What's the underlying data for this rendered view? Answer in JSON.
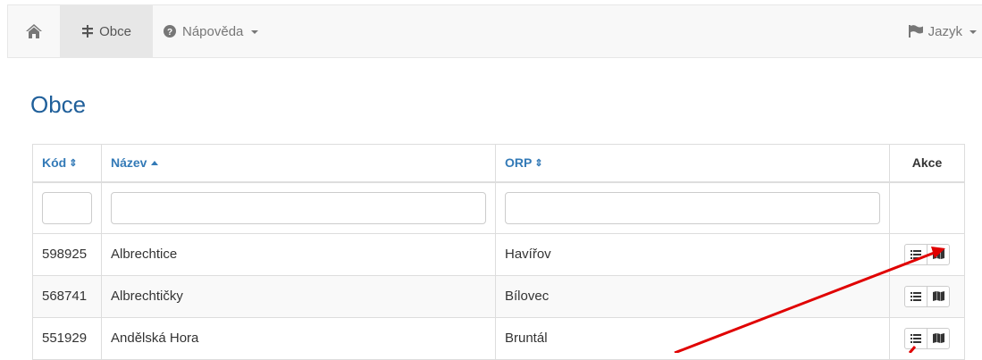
{
  "navbar": {
    "home_icon": "home-icon",
    "obce_label": "Obce",
    "help_label": "Nápověda",
    "lang_label": "Jazyk"
  },
  "page": {
    "title": "Obce"
  },
  "table": {
    "col_kod": "Kód",
    "col_nazev": "Název",
    "col_orp": "ORP",
    "col_akce": "Akce",
    "rows": [
      {
        "kod": "598925",
        "nazev": "Albrechtice",
        "orp": "Havířov"
      },
      {
        "kod": "568741",
        "nazev": "Albrechtičky",
        "orp": "Bílovec"
      },
      {
        "kod": "551929",
        "nazev": "Andělská Hora",
        "orp": "Bruntál"
      }
    ]
  },
  "annotation": {
    "arrow_color": "#e00000"
  }
}
